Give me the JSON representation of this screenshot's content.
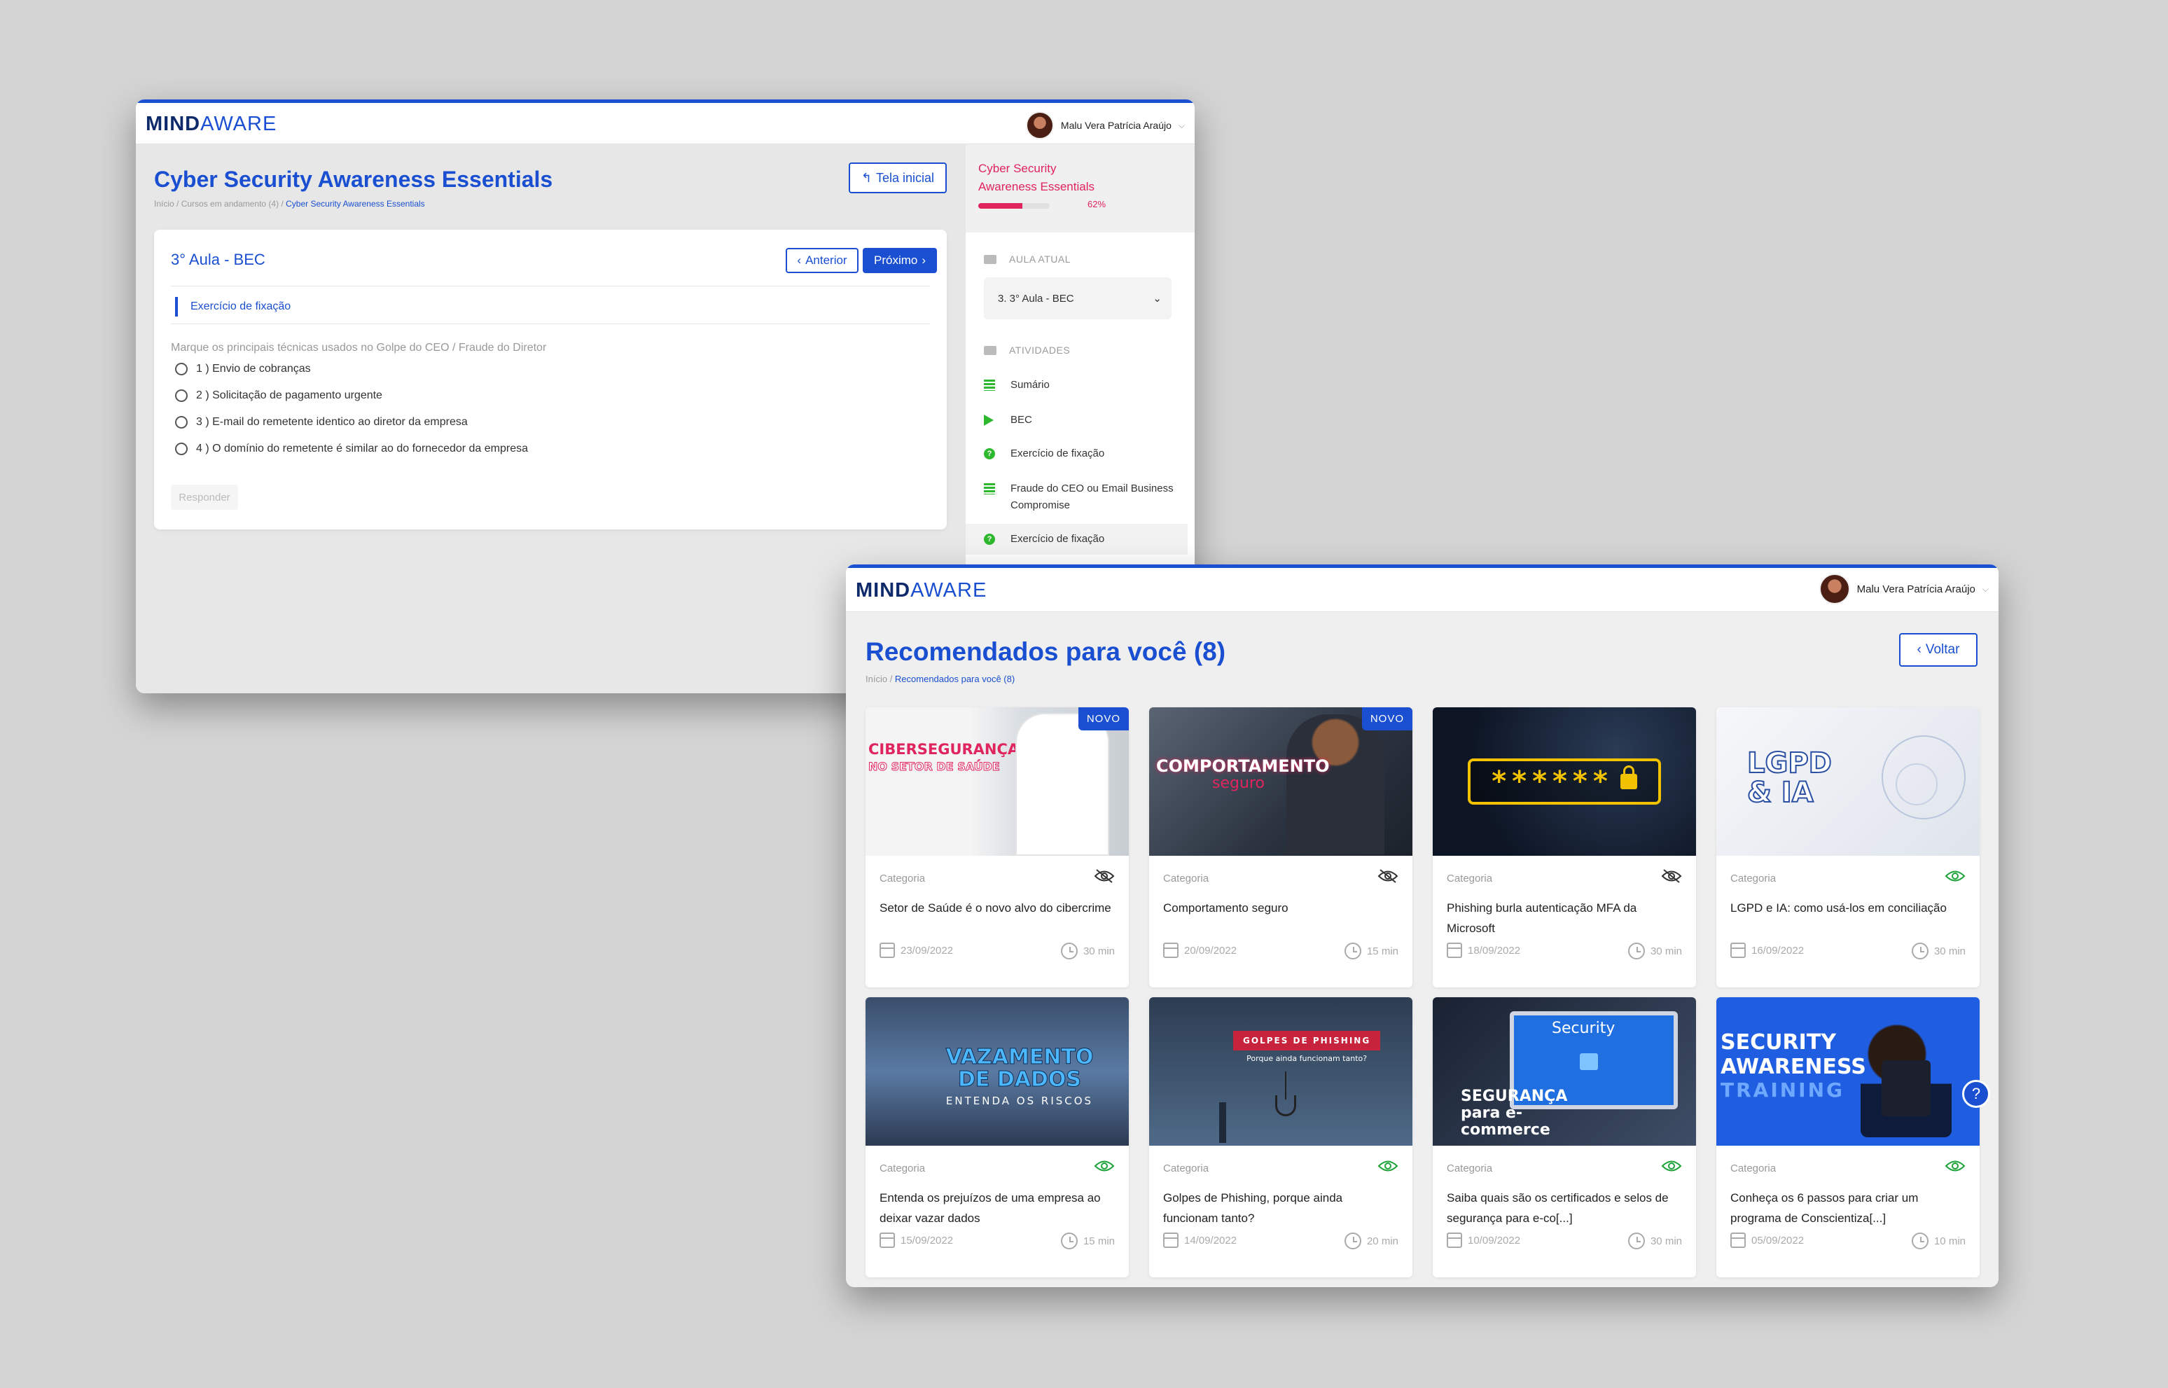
{
  "brand": {
    "logo_mind": "MIND",
    "logo_aware": "AWARE",
    "accent": "#1a4fd1",
    "highlight": "#e0245e"
  },
  "window1": {
    "user_name": "Malu Vera Patrícia Araújo",
    "title": "Cyber Security Awareness Essentials",
    "breadcrumb": {
      "home": "Início",
      "sep1": " / ",
      "courses": "Cursos em andamento (4)",
      "sep2": " / ",
      "current": "Cyber Security Awareness Essentials"
    },
    "home_button": "Tela inicial",
    "lesson_title": "3° Aula - BEC",
    "prev_button": "Anterior",
    "next_button": "Próximo",
    "section": "Exercício de fixação",
    "question": "Marque os principais técnicas usados no Golpe do CEO / Fraude do Diretor",
    "options": [
      "1 ) Envio de cobranças",
      "2 ) Solicitação de pagamento urgente",
      "3 ) E-mail do remetente identico ao diretor da empresa",
      "4 ) O domínio do remetente é similar ao do fornecedor da empresa"
    ],
    "answer_button": "Responder",
    "sidebar": {
      "course_line1": "Cyber Security",
      "course_line2": "Awareness Essentials",
      "progress": 0.62,
      "progress_label": "62%",
      "current_label": "AULA ATUAL",
      "current_select": "3. 3° Aula - BEC",
      "activities_label": "ATIVIDADES",
      "activities": [
        {
          "label": "Sumário",
          "icon": "list-icon"
        },
        {
          "label": "BEC",
          "icon": "play-icon"
        },
        {
          "label": "Exercício de fixação",
          "icon": "question-icon"
        },
        {
          "label": "Fraude do CEO ou Email Business Compromise",
          "icon": "list-icon"
        },
        {
          "label": "Exercício de fixação",
          "icon": "question-icon"
        }
      ]
    }
  },
  "window2": {
    "user_name": "Malu Vera Patrícia Araújo",
    "title": "Recomendados para você (8)",
    "breadcrumb": {
      "home": "Início",
      "sep": " / ",
      "current": "Recomendados para você (8)"
    },
    "back_button": "Voltar",
    "badge_new": "NOVO",
    "cards": [
      {
        "category": "Categoria",
        "title": "Setor de Saúde é o novo alvo do cibercrime",
        "date": "23/09/2022",
        "duration": "30 min",
        "visible": false,
        "thumb_line1": "CIBERSEGURANÇA",
        "thumb_line2": "NO SETOR DE SAÚDE"
      },
      {
        "category": "Categoria",
        "title": "Comportamento seguro",
        "date": "20/09/2022",
        "duration": "15 min",
        "visible": false,
        "thumb_line1": "COMPORTAMENTO",
        "thumb_line2": "seguro"
      },
      {
        "category": "Categoria",
        "title": "Phishing burla autenticação MFA da Microsoft",
        "date": "18/09/2022",
        "duration": "30 min",
        "visible": false,
        "thumb_line1": "******",
        "thumb_line2": ""
      },
      {
        "category": "Categoria",
        "title": "LGPD e IA: como usá-los em conciliação",
        "date": "16/09/2022",
        "duration": "30 min",
        "visible": true,
        "thumb_line1": "LGPD",
        "thumb_line2": "& IA"
      },
      {
        "category": "Categoria",
        "title": "Entenda os prejuízos de uma empresa ao deixar vazar dados",
        "date": "15/09/2022",
        "duration": "15 min",
        "visible": true,
        "thumb_line1": "VAZAMENTO DE DADOS",
        "thumb_line2": "ENTENDA OS RISCOS"
      },
      {
        "category": "Categoria",
        "title": "Golpes de Phishing, porque ainda funcionam tanto?",
        "date": "14/09/2022",
        "duration": "20 min",
        "visible": true,
        "thumb_line1": "GOLPES DE PHISHING",
        "thumb_line2": "Porque ainda funcionam tanto?"
      },
      {
        "category": "Categoria",
        "title": "Saiba quais são os certificados e selos de segurança para e-co[...]",
        "date": "10/09/2022",
        "duration": "30 min",
        "visible": true,
        "thumb_line1": "Security",
        "thumb_line2": "SEGURANÇA para e-commerce"
      },
      {
        "category": "Categoria",
        "title": "Conheça os 6 passos para criar um programa de Conscientiza[...]",
        "date": "05/09/2022",
        "duration": "10 min",
        "visible": true,
        "thumb_line1": "SECURITY AWARENESS",
        "thumb_line2": "TRAINING"
      }
    ]
  }
}
